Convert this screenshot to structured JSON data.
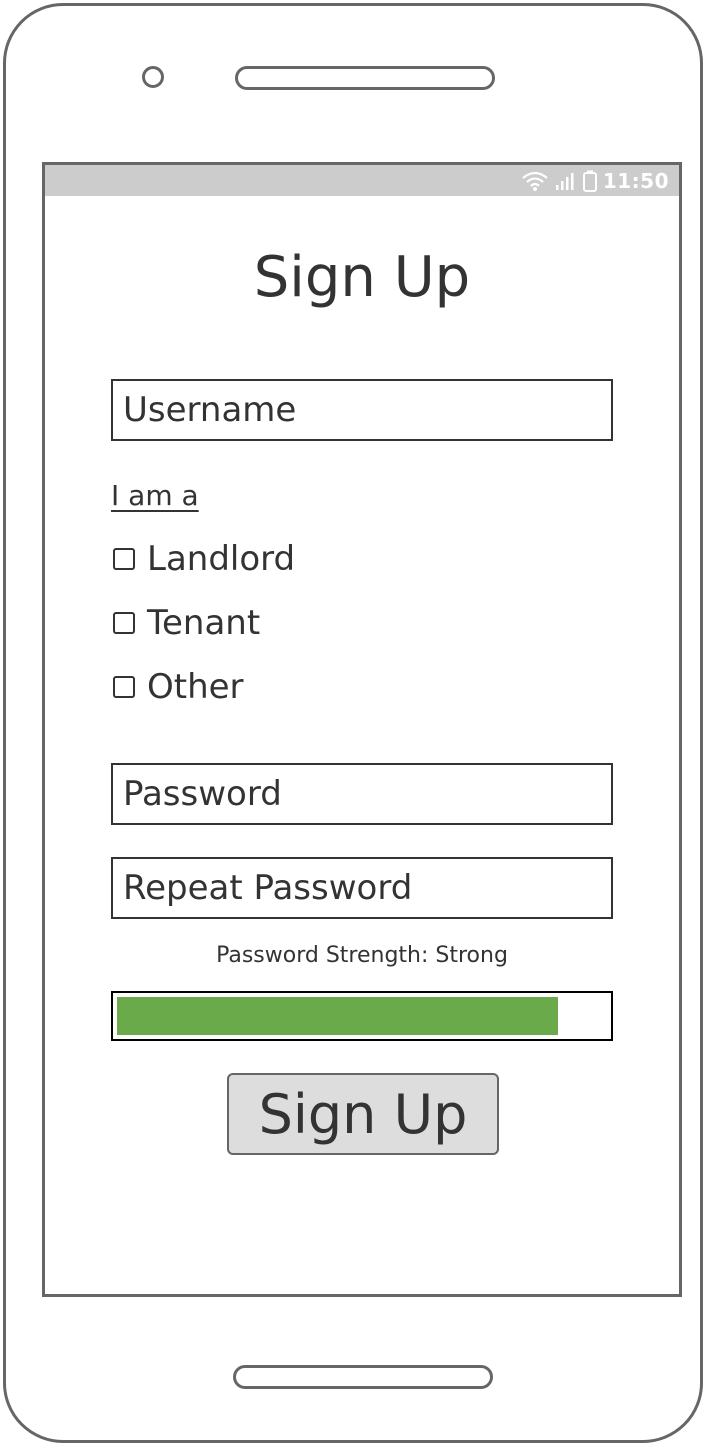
{
  "status_bar": {
    "time": "11:50",
    "icons": [
      "wifi-icon",
      "signal-icon",
      "battery-icon"
    ]
  },
  "title": "Sign Up",
  "fields": {
    "username_placeholder": "Username",
    "password_placeholder": "Password",
    "repeat_password_placeholder": "Repeat Password"
  },
  "role": {
    "label": "I am a",
    "options": [
      {
        "label": "Landlord",
        "checked": false
      },
      {
        "label": "Tenant",
        "checked": false
      },
      {
        "label": "Other",
        "checked": false
      }
    ]
  },
  "password_strength": {
    "label": "Password Strength: Strong",
    "fraction": 0.9,
    "color": "#6aaa4b"
  },
  "submit_label": "Sign Up"
}
